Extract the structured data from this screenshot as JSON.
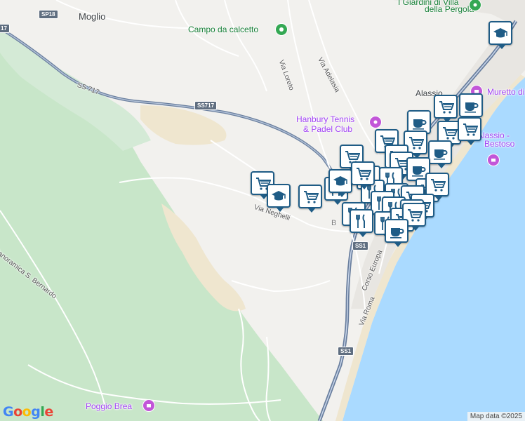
{
  "map": {
    "place_labels": {
      "moglio": "Moglio",
      "alassio": "Alassio",
      "giardini_line1": "I Giardini di Villa",
      "giardini_line2": "della Pergola"
    },
    "poi_labels": {
      "campo": "Campo da calcetto",
      "hanbury_line1": "Hanbury Tennis",
      "hanbury_line2": "& Padel Club",
      "muretto": "Muretto di",
      "bestoso_line1": "Alassio -",
      "bestoso_line2": "Bestoso",
      "poggio": "Poggio Brea",
      "b_fragment": "B"
    },
    "road_labels": {
      "via_loreto": "Via Loreto",
      "via_adelasia": "Via Adelasia",
      "via_neghelli": "Via Neghelli",
      "corso_europa": "Corso Europa",
      "via_roma": "Via Roma",
      "panoramica": "Panoramica S. Bernardo",
      "ss717_road": "SS 717"
    },
    "shields": {
      "sp18": "SP18",
      "ss717": "SS717",
      "ss1_upper": "SS1",
      "ss1_lower": "SS1",
      "edge_label": "17"
    },
    "markers": [
      {
        "icon": "education"
      },
      {
        "icon": "cart"
      },
      {
        "icon": "coffee"
      },
      {
        "icon": "coffee"
      },
      {
        "icon": "cart"
      },
      {
        "icon": "cart"
      },
      {
        "icon": "cart"
      },
      {
        "icon": "cart"
      },
      {
        "icon": "coffee"
      },
      {
        "icon": "cart"
      },
      {
        "icon": "cart"
      },
      {
        "icon": "cart"
      },
      {
        "icon": "restaurant"
      },
      {
        "icon": "restaurant"
      },
      {
        "icon": "coffee"
      },
      {
        "icon": "cart"
      },
      {
        "icon": "education"
      },
      {
        "icon": "restaurant"
      },
      {
        "icon": "restaurant"
      },
      {
        "icon": "cart"
      },
      {
        "icon": "cart"
      },
      {
        "icon": "education"
      },
      {
        "icon": "cart"
      },
      {
        "icon": "restaurant"
      },
      {
        "icon": "cart"
      },
      {
        "icon": "restaurant"
      },
      {
        "icon": "cart"
      },
      {
        "icon": "cart"
      },
      {
        "icon": "restaurant"
      },
      {
        "icon": "restaurant"
      },
      {
        "icon": "restaurant"
      },
      {
        "icon": "restaurant"
      },
      {
        "icon": "restaurant"
      },
      {
        "icon": "cart"
      },
      {
        "icon": "cart"
      },
      {
        "icon": "coffee"
      }
    ],
    "colors": {
      "sea": "#aadaff",
      "land": "#f2f1ee",
      "park": "#c8e6c9",
      "sand": "#efe6cf",
      "highway": "#6a7f9e",
      "road": "#ffffff",
      "marker_border": "#1f5c86",
      "poi_green": "#34a853",
      "poi_purple": "#c256d8"
    },
    "branding": {
      "google": "Google",
      "attribution": "Map data ©2025"
    }
  }
}
